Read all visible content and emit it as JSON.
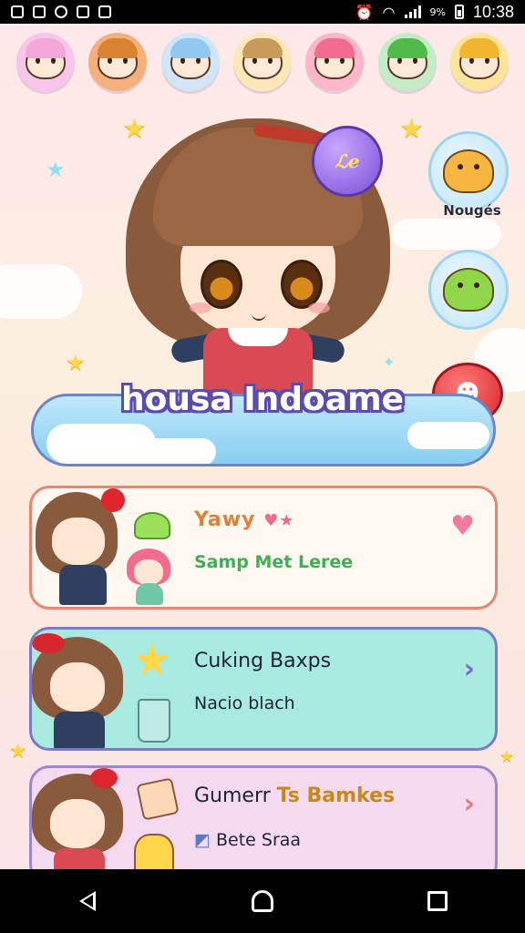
{
  "status_bar": {
    "time": "10:38",
    "battery_pct": "9%",
    "icons": [
      "app-icon-1",
      "app-icon-2",
      "app-icon-3",
      "app-icon-4",
      "app-icon-5",
      "alarm-icon",
      "wifi-icon",
      "signal-icon",
      "battery-icon"
    ]
  },
  "avatar_row": {
    "items": [
      {
        "name": "pink-cat",
        "bg": "#f7c4ea",
        "hair": "#f3a6d8"
      },
      {
        "name": "orange-lion",
        "bg": "#f3b07a",
        "hair": "#d9832f"
      },
      {
        "name": "blue-girl",
        "bg": "#cfe6f8",
        "hair": "#93c8ee"
      },
      {
        "name": "brown-boy",
        "bg": "#fde6b8",
        "hair": "#c79b5a"
      },
      {
        "name": "pink-girl",
        "bg": "#fbb7c9",
        "hair": "#f26c8e"
      },
      {
        "name": "green-frog",
        "bg": "#c3ecc4",
        "hair": "#4fb94a"
      },
      {
        "name": "yellow-cat",
        "bg": "#fde49b",
        "hair": "#f0b630"
      }
    ]
  },
  "hero": {
    "title": "housa Indoame",
    "badge_text": "ℒe"
  },
  "side_buttons": {
    "top_label": "Nougés"
  },
  "cards": [
    {
      "title": "Yawy",
      "title_hearts": "♥★",
      "subtitle": "Samp Met Leree",
      "chevron": "♥"
    },
    {
      "title": "Cuking Baxps",
      "subtitle": "Nacio blach",
      "chevron": "›"
    },
    {
      "title_prefix": "Gumerr",
      "title_em": "Ts Bamkes",
      "subtitle_icon": "◩",
      "subtitle": "Bete Sraa",
      "chevron": "›"
    }
  ],
  "nav": {
    "buttons": [
      "back",
      "home",
      "recents"
    ]
  },
  "colors": {
    "title_outline": "#5a4cae",
    "card1_border": "#e7866e",
    "card2_bg": "#a8eadf",
    "card3_bg": "#f5d9ef"
  }
}
